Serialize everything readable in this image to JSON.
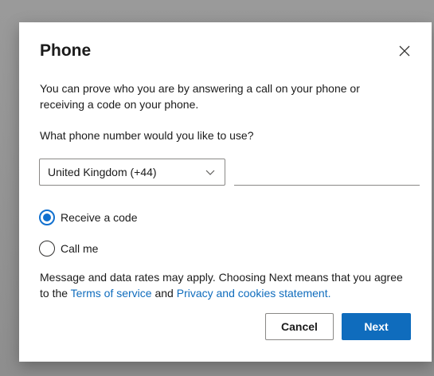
{
  "dialog": {
    "title": "Phone",
    "close_icon": "close-icon",
    "description": "You can prove who you are by answering a call on your phone or receiving a code on your phone.",
    "question": "What phone number would you like to use?",
    "country_select": {
      "selected": "United Kingdom (+44)",
      "icon": "chevron-down-icon"
    },
    "phone_input": {
      "value": "",
      "placeholder": ""
    },
    "options": [
      {
        "label": "Receive a code",
        "checked": true
      },
      {
        "label": "Call me",
        "checked": false
      }
    ],
    "notice": {
      "text_before": "Message and data rates may apply. Choosing Next means that you agree to the ",
      "terms_link": "Terms of service",
      "text_and": " and ",
      "privacy_link": "Privacy and cookies statement."
    },
    "buttons": {
      "cancel": "Cancel",
      "next": "Next"
    }
  },
  "colors": {
    "accent": "#0f6cbd",
    "radio_accent": "#1170cf",
    "backdrop": "#8e8e8e"
  }
}
